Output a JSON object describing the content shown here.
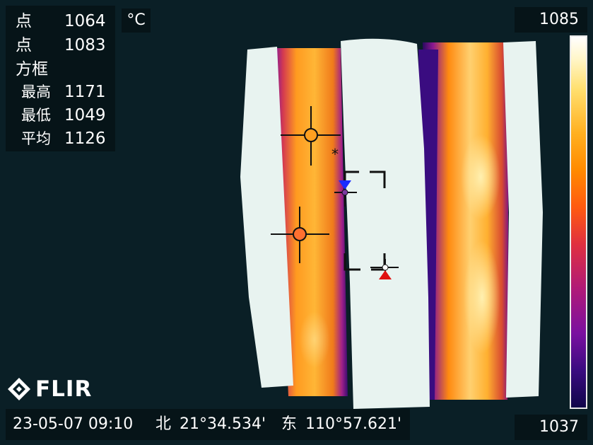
{
  "measurements": {
    "spot1": {
      "label": "点",
      "value": "1064"
    },
    "spot2": {
      "label": "点",
      "value": "1083"
    },
    "box": {
      "label": "方框"
    },
    "max": {
      "label": "最高",
      "value": "1171"
    },
    "min": {
      "label": "最低",
      "value": "1049"
    },
    "avg": {
      "label": "平均",
      "value": "1126"
    }
  },
  "unit": "°C",
  "scale": {
    "max": "1085",
    "min": "1037"
  },
  "status": {
    "datetime": "23-05-07 09:10",
    "lat_dir": "北",
    "lat": "21°34.534'",
    "lon_dir": "东",
    "lon": "110°57.621'"
  },
  "logo": "FLIR",
  "colors": {
    "background": "#0a1f26",
    "hot_white": "#e8f3f0",
    "warm_orange": "#ff9a20",
    "cool_purple": "#5a1090",
    "cold_marker": "#1a2cff",
    "hot_marker": "#e01010"
  },
  "icons": {
    "spot_marker": "crosshair-circle",
    "max_marker": "red-triangle",
    "min_marker": "blue-triangle"
  }
}
